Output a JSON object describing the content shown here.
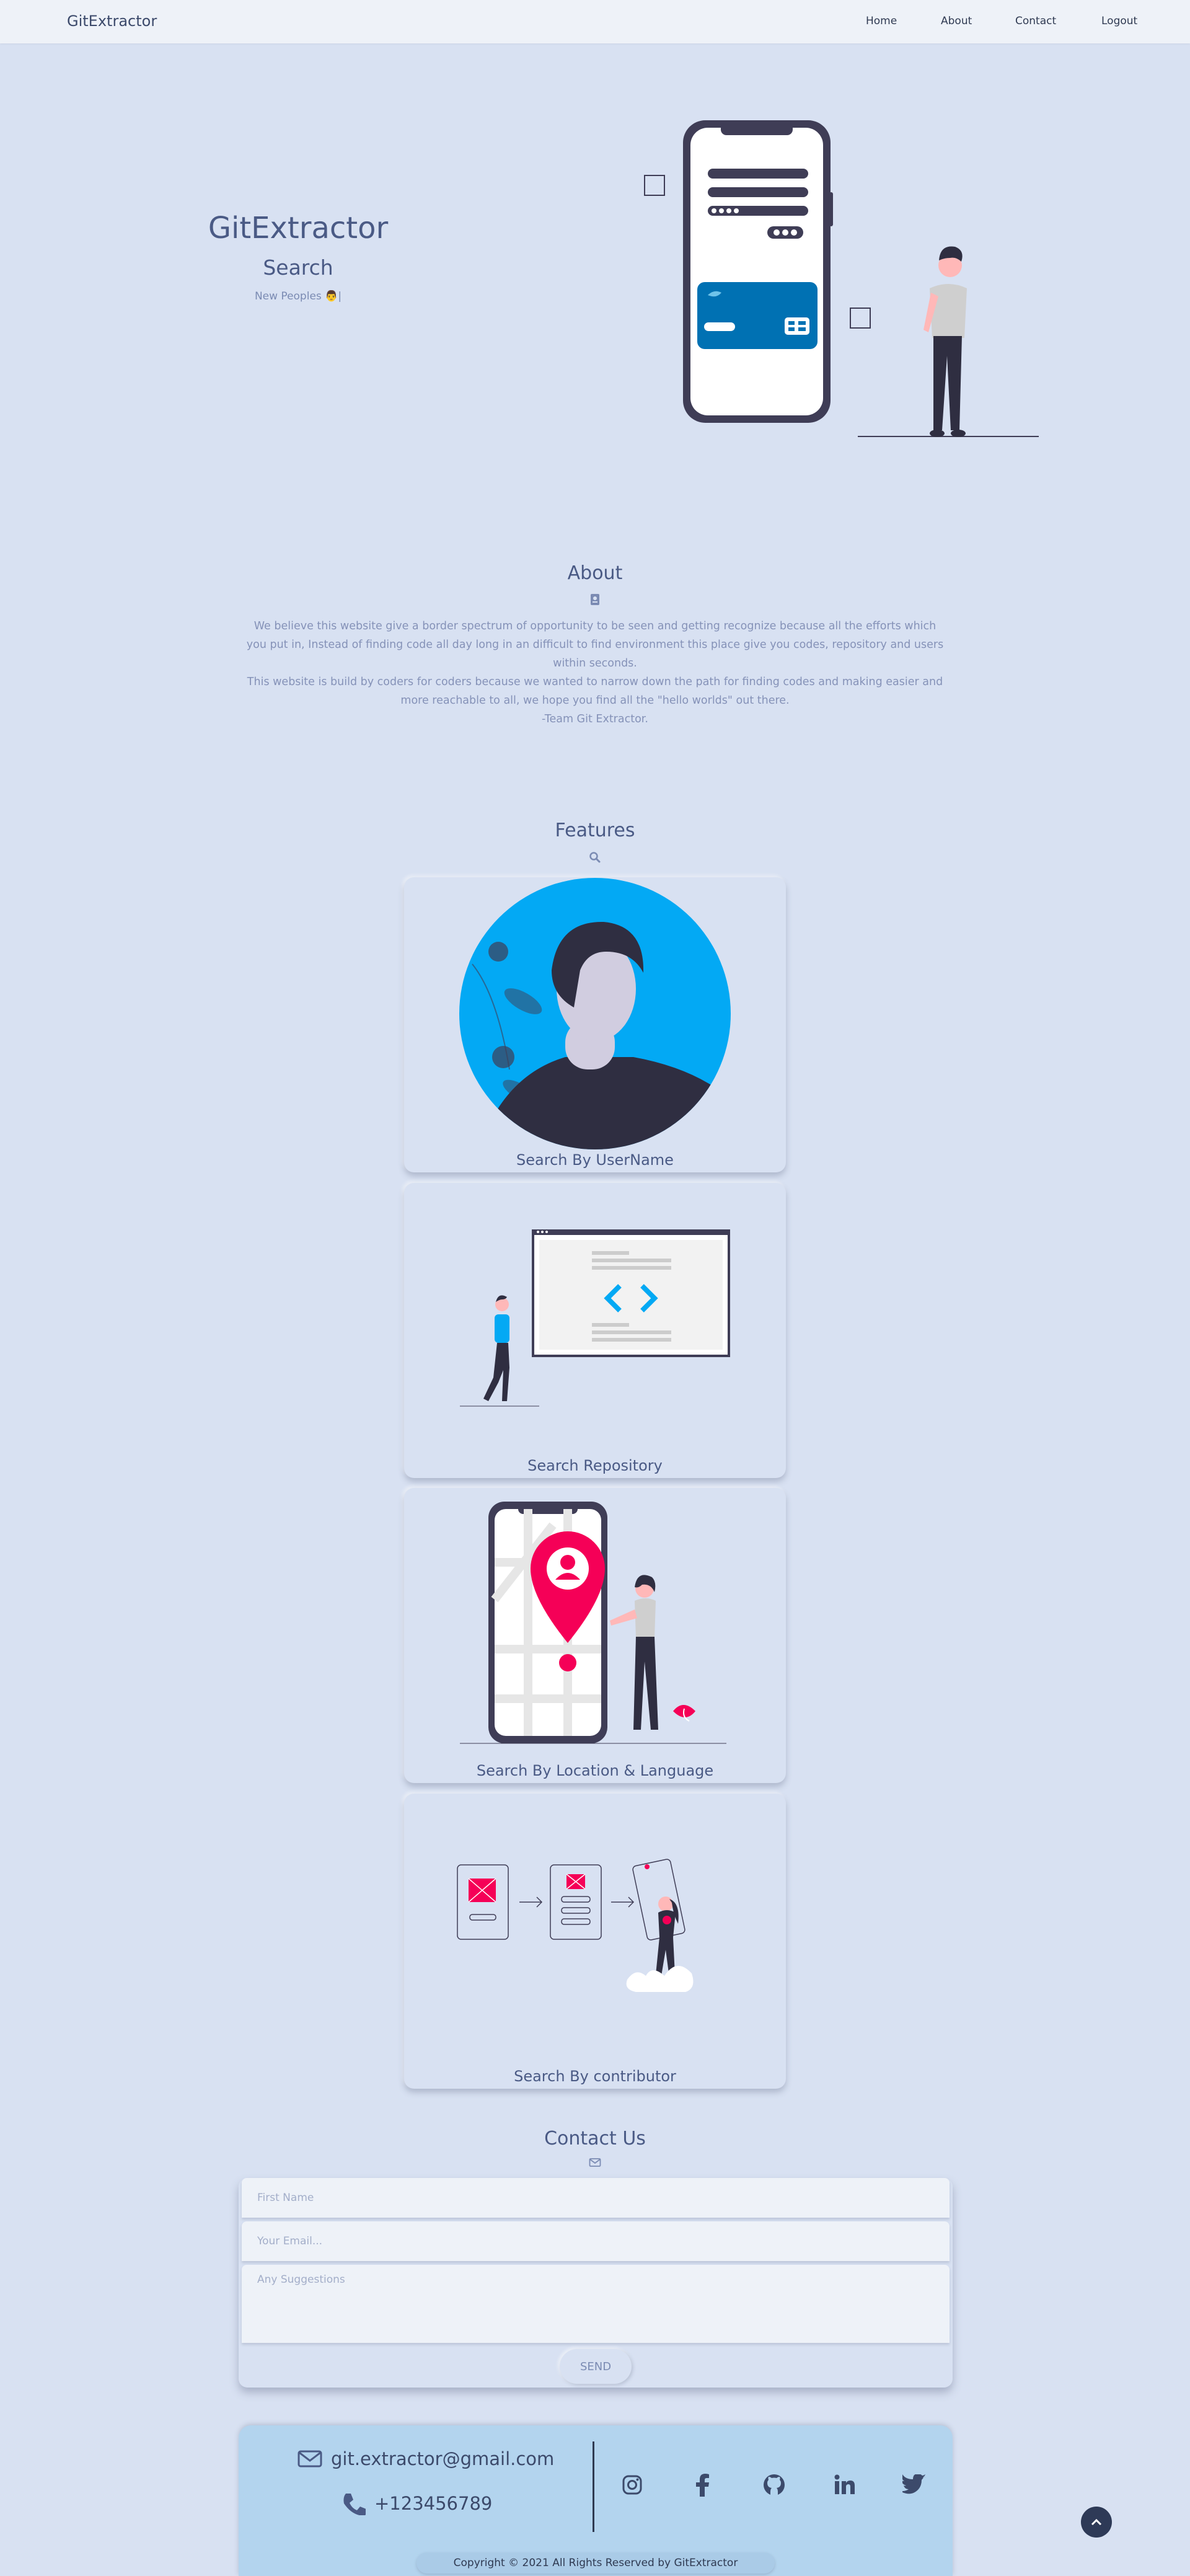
{
  "navbar": {
    "brand": "GitExtractor",
    "items": [
      {
        "label": "Home"
      },
      {
        "label": "About"
      },
      {
        "label": "Contact"
      },
      {
        "label": "Logout"
      }
    ]
  },
  "hero": {
    "title": "GitExtractor",
    "subtitle": "Search",
    "typed_text": "New Peoples 👨|"
  },
  "about": {
    "title": "About",
    "icon": "id-badge-icon",
    "text": "We believe this website give a border spectrum of opportunity to be seen and getting recognize because all the efforts which you put in, Instead of finding code all day long in an difficult to find environment this place give you codes, repository and users within seconds.",
    "text2": "This website is build by coders for coders because we wanted to narrow down the path for finding codes and making easier and more reachable to all, we hope you find all the \"hello worlds\" out there.",
    "signature": "-Team Git Extractor."
  },
  "features": {
    "title": "Features",
    "icon": "search-icon",
    "cards": [
      {
        "label": "Search By UserName"
      },
      {
        "label": "Search Repository"
      },
      {
        "label": "Search By Location & Language"
      },
      {
        "label": "Search By contributor"
      }
    ]
  },
  "contact": {
    "title": "Contact Us",
    "icon": "envelope-icon",
    "first_name_placeholder": "First Name",
    "email_placeholder": "Your Email...",
    "suggestions_placeholder": "Any Suggestions",
    "send_label": "SEND"
  },
  "footer": {
    "email": "git.extractor@gmail.com",
    "phone": "+123456789",
    "socials": [
      "instagram-icon",
      "facebook-icon",
      "github-icon",
      "linkedin-icon",
      "twitter-icon"
    ],
    "copyright": "Copyright © 2021 All Rights Reserved by GitExtractor"
  },
  "colors": {
    "background": "#d8e1f2",
    "navbar": "#eef2f8",
    "footer": "#b3d4ee",
    "accent_blue": "#03a9f4",
    "accent_pink": "#f50057",
    "dark": "#2f2e41"
  }
}
